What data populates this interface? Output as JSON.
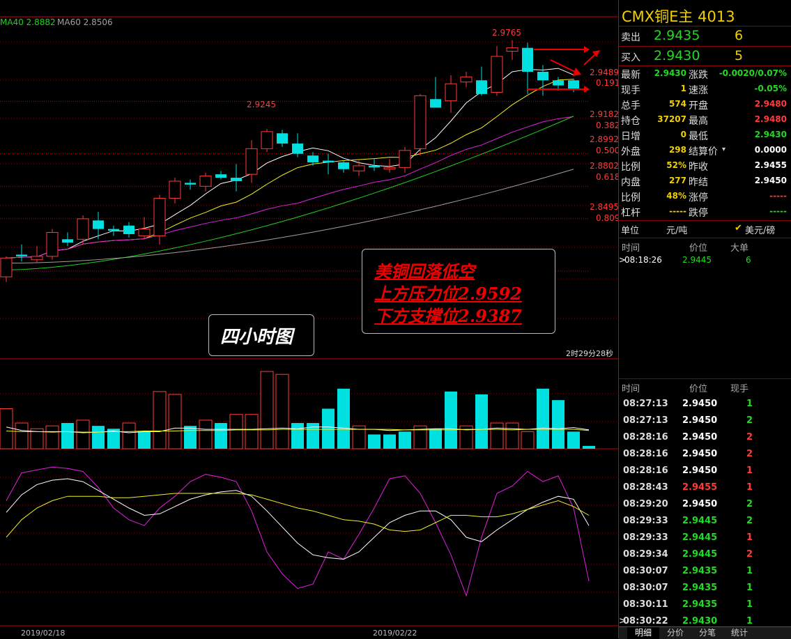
{
  "legend": {
    "ma40": "MA40 2.8882",
    "ma60": "MA60 2.8506"
  },
  "ma_colors": {
    "ma5": "#ffffff",
    "ma10": "#f0f020",
    "ma20": "#e020e0",
    "ma40": "#20d020",
    "ma60": "#a0a0a0"
  },
  "price_labels": {
    "high": "2.9765",
    "mid_high": "2.9245"
  },
  "fib_levels": [
    {
      "price": "2.9489",
      "ratio": "0.191"
    },
    {
      "price": "2.9182",
      "ratio": "0.382"
    },
    {
      "price": "2.8992",
      "ratio": "0.500"
    },
    {
      "price": "2.8802",
      "ratio": "0.618"
    },
    {
      "price": "2.8495",
      "ratio": "0.809"
    }
  ],
  "annotations": {
    "period": "四小时图",
    "line1": "美铜回落低空",
    "line2": "上方压力位2.9592",
    "line3": "下方支撑位2.9387"
  },
  "countdown": "2时29分28秒",
  "dates": [
    "2019/02/18",
    "2019/02/22"
  ],
  "quote": {
    "title": "CMX铜E主  4013",
    "ask_label": "卖出",
    "ask_price": "2.9435",
    "ask_qty": "6",
    "bid_label": "买入",
    "bid_price": "2.9430",
    "bid_qty": "5",
    "stats_left": [
      {
        "label": "最新",
        "value": "2.9430",
        "color": "green"
      },
      {
        "label": "现手",
        "value": "1",
        "color": "yellow"
      },
      {
        "label": "总手",
        "value": "574",
        "color": "yellow"
      },
      {
        "label": "持仓",
        "value": "37207",
        "color": "yellow"
      },
      {
        "label": "日增",
        "value": "0",
        "color": "yellow"
      },
      {
        "label": "外盘",
        "value": "298",
        "color": "yellow"
      },
      {
        "label": "比例",
        "value": "52%",
        "color": "yellow"
      },
      {
        "label": "内盘",
        "value": "277",
        "color": "yellow"
      },
      {
        "label": "比例",
        "value": "48%",
        "color": "yellow"
      },
      {
        "label": "杠杆",
        "value": "-----",
        "color": "yellow"
      }
    ],
    "stats_right": [
      {
        "label": "涨跌",
        "value": "-0.0020/0.07%",
        "color": "green"
      },
      {
        "label": "速涨",
        "value": "-0.05%",
        "color": "green"
      },
      {
        "label": "开盘",
        "value": "2.9480",
        "color": "red"
      },
      {
        "label": "最高",
        "value": "2.9480",
        "color": "red"
      },
      {
        "label": "最低",
        "value": "2.9430",
        "color": "green"
      },
      {
        "label": "结算价",
        "value": "0.0000",
        "color": "white"
      },
      {
        "label": "昨收",
        "value": "2.9455",
        "color": "white"
      },
      {
        "label": "昨结",
        "value": "2.9450",
        "color": "white"
      },
      {
        "label": "涨停",
        "value": "-----",
        "color": "red"
      },
      {
        "label": "跌停",
        "value": "-----",
        "color": "green"
      }
    ],
    "unit_label": "单位",
    "unit_value": "元/吨",
    "unit_option": "美元/磅"
  },
  "big_trades": {
    "headers": [
      "时间",
      "价位",
      "大单"
    ],
    "rows": [
      {
        "time": "08:18:26",
        "price": "2.9445",
        "qty": "6"
      }
    ]
  },
  "ticks": {
    "headers": [
      "时间",
      "价位",
      "现手"
    ],
    "rows": [
      {
        "time": "08:27:13",
        "price": "2.9450",
        "qty": "1",
        "pc": "white",
        "qc": "green"
      },
      {
        "time": "08:27:13",
        "price": "2.9450",
        "qty": "2",
        "pc": "white",
        "qc": "green"
      },
      {
        "time": "08:28:16",
        "price": "2.9450",
        "qty": "2",
        "pc": "white",
        "qc": "red"
      },
      {
        "time": "08:28:16",
        "price": "2.9450",
        "qty": "2",
        "pc": "white",
        "qc": "red"
      },
      {
        "time": "08:28:16",
        "price": "2.9450",
        "qty": "1",
        "pc": "white",
        "qc": "red"
      },
      {
        "time": "08:28:43",
        "price": "2.9455",
        "qty": "1",
        "pc": "red",
        "qc": "red"
      },
      {
        "time": "08:29:20",
        "price": "2.9450",
        "qty": "2",
        "pc": "white",
        "qc": "green"
      },
      {
        "time": "08:29:33",
        "price": "2.9445",
        "qty": "2",
        "pc": "green",
        "qc": "green"
      },
      {
        "time": "08:29:33",
        "price": "2.9445",
        "qty": "1",
        "pc": "green",
        "qc": "red"
      },
      {
        "time": "08:29:34",
        "price": "2.9445",
        "qty": "2",
        "pc": "green",
        "qc": "red"
      },
      {
        "time": "08:30:07",
        "price": "2.9435",
        "qty": "1",
        "pc": "green",
        "qc": "green"
      },
      {
        "time": "08:30:07",
        "price": "2.9435",
        "qty": "1",
        "pc": "green",
        "qc": "green"
      },
      {
        "time": "08:30:11",
        "price": "2.9435",
        "qty": "1",
        "pc": "green",
        "qc": "green"
      },
      {
        "time": "08:30:22",
        "price": "2.9430",
        "qty": "1",
        "pc": "green",
        "qc": "green"
      }
    ]
  },
  "tabs": [
    "明细",
    "分价",
    "分笔",
    "统计"
  ],
  "chart_data": {
    "type": "candlestick",
    "candles": [
      {
        "o": 2.838,
        "h": 2.85,
        "l": 2.835,
        "c": 2.849
      },
      {
        "o": 2.851,
        "h": 2.857,
        "l": 2.847,
        "c": 2.85
      },
      {
        "o": 2.848,
        "h": 2.856,
        "l": 2.846,
        "c": 2.85
      },
      {
        "o": 2.85,
        "h": 2.866,
        "l": 2.848,
        "c": 2.864
      },
      {
        "o": 2.86,
        "h": 2.864,
        "l": 2.856,
        "c": 2.858
      },
      {
        "o": 2.86,
        "h": 2.874,
        "l": 2.857,
        "c": 2.872
      },
      {
        "o": 2.871,
        "h": 2.876,
        "l": 2.86,
        "c": 2.866
      },
      {
        "o": 2.866,
        "h": 2.868,
        "l": 2.862,
        "c": 2.865
      },
      {
        "o": 2.868,
        "h": 2.87,
        "l": 2.861,
        "c": 2.863
      },
      {
        "o": 2.862,
        "h": 2.873,
        "l": 2.86,
        "c": 2.866
      },
      {
        "o": 2.862,
        "h": 2.886,
        "l": 2.857,
        "c": 2.884
      },
      {
        "o": 2.884,
        "h": 2.896,
        "l": 2.881,
        "c": 2.894
      },
      {
        "o": 2.893,
        "h": 2.895,
        "l": 2.889,
        "c": 2.892
      },
      {
        "o": 2.891,
        "h": 2.899,
        "l": 2.888,
        "c": 2.897
      },
      {
        "o": 2.898,
        "h": 2.9,
        "l": 2.895,
        "c": 2.896
      },
      {
        "o": 2.896,
        "h": 2.904,
        "l": 2.888,
        "c": 2.894
      },
      {
        "o": 2.898,
        "h": 2.918,
        "l": 2.893,
        "c": 2.913
      },
      {
        "o": 2.913,
        "h": 2.9245,
        "l": 2.911,
        "c": 2.923
      },
      {
        "o": 2.922,
        "h": 2.924,
        "l": 2.914,
        "c": 2.916
      },
      {
        "o": 2.916,
        "h": 2.922,
        "l": 2.908,
        "c": 2.91
      },
      {
        "o": 2.909,
        "h": 2.911,
        "l": 2.903,
        "c": 2.905
      },
      {
        "o": 2.906,
        "h": 2.91,
        "l": 2.898,
        "c": 2.905
      },
      {
        "o": 2.905,
        "h": 2.906,
        "l": 2.899,
        "c": 2.901
      },
      {
        "o": 2.9,
        "h": 2.906,
        "l": 2.897,
        "c": 2.903
      },
      {
        "o": 2.903,
        "h": 2.907,
        "l": 2.9,
        "c": 2.902
      },
      {
        "o": 2.901,
        "h": 2.907,
        "l": 2.899,
        "c": 2.902
      },
      {
        "o": 2.902,
        "h": 2.914,
        "l": 2.899,
        "c": 2.912
      },
      {
        "o": 2.913,
        "h": 2.945,
        "l": 2.909,
        "c": 2.944
      },
      {
        "o": 2.942,
        "h": 2.955,
        "l": 2.94,
        "c": 2.937
      },
      {
        "o": 2.941,
        "h": 2.956,
        "l": 2.934,
        "c": 2.951
      },
      {
        "o": 2.952,
        "h": 2.958,
        "l": 2.949,
        "c": 2.955
      },
      {
        "o": 2.953,
        "h": 2.961,
        "l": 2.944,
        "c": 2.945
      },
      {
        "o": 2.946,
        "h": 2.973,
        "l": 2.944,
        "c": 2.967
      },
      {
        "o": 2.97,
        "h": 2.9765,
        "l": 2.965,
        "c": 2.972
      },
      {
        "o": 2.972,
        "h": 2.975,
        "l": 2.945,
        "c": 2.958
      },
      {
        "o": 2.958,
        "h": 2.962,
        "l": 2.944,
        "c": 2.953
      },
      {
        "o": 2.953,
        "h": 2.955,
        "l": 2.947,
        "c": 2.95
      },
      {
        "o": 2.953,
        "h": 2.954,
        "l": 2.946,
        "c": 2.948
      }
    ],
    "volume": [
      70,
      45,
      35,
      40,
      45,
      50,
      40,
      35,
      45,
      30,
      100,
      95,
      40,
      50,
      45,
      60,
      60,
      135,
      130,
      45,
      45,
      70,
      105,
      40,
      25,
      25,
      30,
      40,
      35,
      100,
      40,
      95,
      45,
      45,
      30,
      105,
      85,
      30,
      5
    ],
    "volume_up": [
      true,
      true,
      true,
      true,
      false,
      true,
      false,
      false,
      true,
      false,
      true,
      true,
      false,
      true,
      false,
      true,
      true,
      true,
      true,
      false,
      false,
      false,
      false,
      true,
      false,
      false,
      false,
      true,
      false,
      false,
      true,
      false,
      true,
      true,
      true,
      false,
      false,
      false,
      false
    ],
    "vol_ma": [
      38,
      32,
      30,
      30,
      30,
      28,
      29,
      31,
      28,
      30,
      30,
      36,
      36,
      34,
      34,
      34,
      34,
      35,
      36,
      35,
      38,
      38,
      36,
      34,
      34,
      32,
      33,
      34,
      35,
      35,
      33,
      34,
      36,
      35,
      34,
      36,
      35,
      37,
      33
    ],
    "vol_ma2": [
      31,
      30,
      30,
      29,
      30,
      29,
      29,
      30,
      30,
      31,
      31,
      31,
      32,
      32,
      32,
      33,
      33,
      33,
      34,
      34,
      34,
      34,
      34,
      34,
      34,
      34,
      33,
      33,
      33,
      33,
      34,
      34,
      34,
      33,
      34,
      34,
      34,
      34,
      32
    ],
    "osc_k": [
      65,
      84,
      86,
      88,
      87,
      85,
      74,
      60,
      52,
      48,
      60,
      68,
      78,
      83,
      81,
      78,
      58,
      30,
      15,
      5,
      8,
      30,
      25,
      42,
      60,
      80,
      82,
      70,
      50,
      28,
      0,
      40,
      70,
      75,
      85,
      78,
      82,
      60,
      10
    ],
    "osc_d": [
      57,
      69,
      76,
      79,
      80,
      78,
      72,
      66,
      60,
      55,
      56,
      61,
      66,
      69,
      71,
      72,
      68,
      58,
      47,
      36,
      28,
      26,
      25,
      30,
      40,
      50,
      55,
      58,
      58,
      52,
      40,
      37,
      45,
      52,
      59,
      64,
      68,
      66,
      48
    ],
    "osc_j": [
      40,
      52,
      60,
      65,
      68,
      68,
      68,
      67,
      67,
      68,
      69,
      70,
      70,
      70,
      70,
      70,
      69,
      66,
      63,
      60,
      58,
      55,
      52,
      51,
      49,
      45,
      44,
      45,
      50,
      55,
      55,
      54,
      54,
      56,
      59,
      62,
      65,
      61,
      55
    ]
  }
}
